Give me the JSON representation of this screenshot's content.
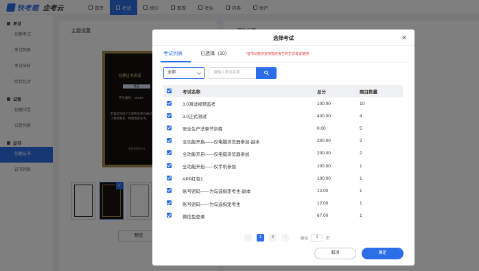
{
  "brand": {
    "name": "快考题",
    "sub": "企考云"
  },
  "nav": [
    {
      "label": "首页",
      "active": false
    },
    {
      "label": "考试",
      "active": true
    },
    {
      "label": "培训",
      "active": false
    },
    {
      "label": "题库",
      "active": false
    },
    {
      "label": "考生",
      "active": false
    },
    {
      "label": "问卷",
      "active": false
    },
    {
      "label": "账户",
      "active": false
    }
  ],
  "sidebar": {
    "groups": [
      {
        "label": "考试",
        "items": [
          {
            "label": "创建考试",
            "active": false
          },
          {
            "label": "考试列表",
            "active": false
          },
          {
            "label": "考试分析",
            "active": false
          },
          {
            "label": "综合比对",
            "active": false
          }
        ]
      },
      {
        "label": "试卷",
        "items": [
          {
            "label": "创建试卷",
            "active": false
          },
          {
            "label": "试卷列表",
            "active": false
          }
        ]
      },
      {
        "label": "证书",
        "items": [
          {
            "label": "创建证书",
            "active": true
          },
          {
            "label": "证书列表",
            "active": false
          }
        ]
      }
    ]
  },
  "background": {
    "main_title": "主题设置",
    "right_title": "基础设置",
    "certificate": {
      "title": "创建证书测试",
      "name": "姓名",
      "number": "考生编号：46SDF",
      "body": "恭喜您完成了全部考试并且通过了相关要求，特颁发此证书。",
      "date": "发证时间2021"
    },
    "preview_label": "预览"
  },
  "modal": {
    "title": "选择考试",
    "close": "×",
    "tabs": [
      {
        "label": "考试列表",
        "active": true
      },
      {
        "label": "已选择（10）",
        "active": false
      }
    ],
    "note": "*证书功能仅支持指定考生的正式考试使用",
    "filter": {
      "select": "全部",
      "search_placeholder": "请输入考试名称"
    },
    "table": {
      "headers": {
        "name": "考试名称",
        "score": "总分",
        "count": "题目数量"
      },
      "rows": [
        {
          "name": "3.0测试视频监考",
          "score": "100.00",
          "count": "10"
        },
        {
          "name": "3.0正式测试",
          "score": "400.00",
          "count": "4"
        },
        {
          "name": "安全生产法章节训练",
          "score": "0.00",
          "count": "5"
        },
        {
          "name": "全功能开启——仅电脑浏览器参加-副本",
          "score": "200.00",
          "count": "2"
        },
        {
          "name": "全功能开启——仅电脑浏览器参加",
          "score": "200.00",
          "count": "2"
        },
        {
          "name": "全功能开启——仅手机参加",
          "score": "100.00",
          "count": "1"
        },
        {
          "name": "APP红包1",
          "score": "100.00",
          "count": "1"
        },
        {
          "name": "账号密码——为勾选指定考生-副本",
          "score": "12.00",
          "count": "1"
        },
        {
          "name": "账号密码——为勾选指定考生",
          "score": "12.00",
          "count": "1"
        },
        {
          "name": "微信免登录",
          "score": "67.00",
          "count": "1"
        }
      ]
    },
    "pager": {
      "prev": "‹",
      "pages": [
        "1",
        "2"
      ],
      "next": "›",
      "goto_label": "前往",
      "goto_value": "1",
      "page_suffix": "页"
    },
    "cancel_label": "取消",
    "confirm_label": "确定"
  },
  "colors": {
    "accent": "#2c6ee8",
    "note": "#e53935"
  }
}
